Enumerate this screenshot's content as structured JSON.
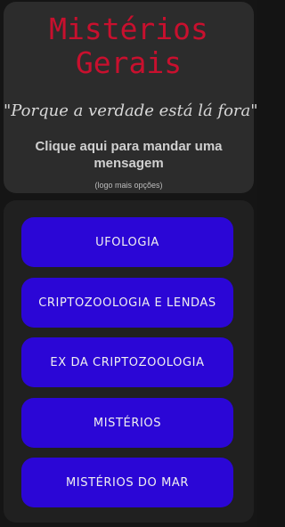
{
  "header": {
    "title_line1": "Mistérios",
    "title_line2": "Gerais",
    "tagline": "\"Porque a verdade está lá fora\"",
    "cta_line1": "Clique aqui para mandar uma",
    "cta_line2": "mensagem",
    "hint": "(logo mais opções)"
  },
  "menu": {
    "items": [
      {
        "label": "UFOLOGIA"
      },
      {
        "label": "CRIPTOZOOLOGIA E LENDAS"
      },
      {
        "label": "EX DA CRIPTOZOOLOGIA"
      },
      {
        "label": "MISTÉRIOS"
      },
      {
        "label": "MISTÉRIOS DO MAR"
      }
    ]
  },
  "colors": {
    "title": "#c8102e",
    "button": "#2b06d6",
    "background": "#151515",
    "card": "#2c2c2c"
  }
}
